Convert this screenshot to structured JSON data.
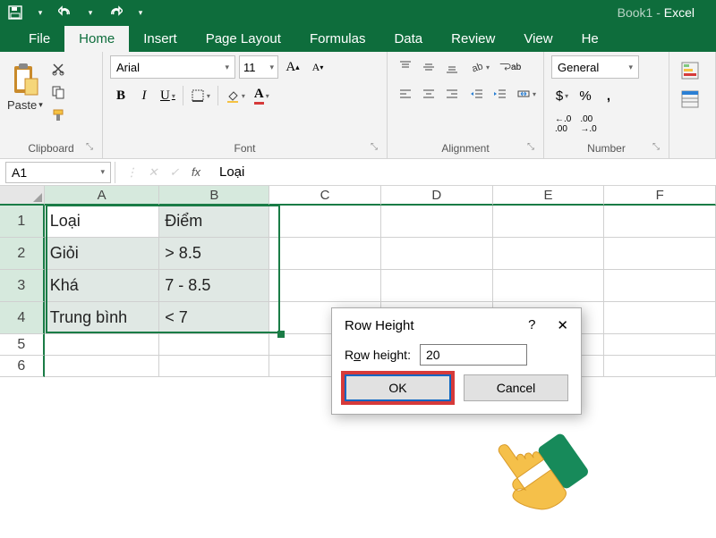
{
  "title": {
    "book": "Book1",
    "sep": " - ",
    "app": "Excel"
  },
  "tabs": [
    "File",
    "Home",
    "Insert",
    "Page Layout",
    "Formulas",
    "Data",
    "Review",
    "View",
    "He"
  ],
  "active_tab": 1,
  "clipboard": {
    "paste": "Paste",
    "label": "Clipboard"
  },
  "font": {
    "name": "Arial",
    "size": "11",
    "bold": "B",
    "italic": "I",
    "underline": "U",
    "label": "Font"
  },
  "alignment": {
    "label": "Alignment",
    "wrap_suffix": "ab"
  },
  "number": {
    "format": "General",
    "currency": "$",
    "percent": "%",
    "comma": ",",
    "inc": ".0",
    "inc2": ".00",
    "label": "Number"
  },
  "formula_bar": {
    "cell_ref": "A1",
    "fx": "fx",
    "value": "Loại"
  },
  "columns": [
    {
      "id": "A",
      "w": 134,
      "sel": true
    },
    {
      "id": "B",
      "w": 128,
      "sel": true
    },
    {
      "id": "C",
      "w": 130,
      "sel": false
    },
    {
      "id": "D",
      "w": 130,
      "sel": false
    },
    {
      "id": "E",
      "w": 130,
      "sel": false
    },
    {
      "id": "F",
      "w": 130,
      "sel": false
    }
  ],
  "rows": [
    {
      "n": "1",
      "h": 36,
      "sel": true
    },
    {
      "n": "2",
      "h": 36,
      "sel": true
    },
    {
      "n": "3",
      "h": 36,
      "sel": true
    },
    {
      "n": "4",
      "h": 36,
      "sel": true
    },
    {
      "n": "5",
      "h": 24,
      "sel": false
    },
    {
      "n": "6",
      "h": 24,
      "sel": false
    }
  ],
  "cells": {
    "A1": "Loại",
    "B1": "Điểm",
    "A2": "Giỏi",
    "B2": "> 8.5",
    "A3": "Khá",
    "B3": "7 - 8.5",
    "A4": "Trung bình",
    "B4": "< 7"
  },
  "dialog": {
    "title": "Row Height",
    "help": "?",
    "close": "✕",
    "label_pre": "R",
    "label_u": "o",
    "label_post": "w height:",
    "value": "20",
    "ok": "OK",
    "cancel": "Cancel"
  }
}
